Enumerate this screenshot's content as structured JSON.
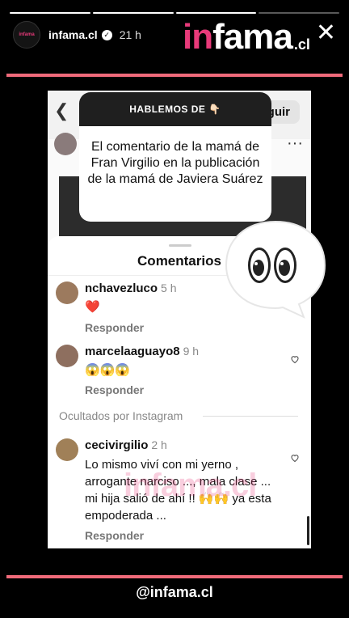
{
  "story": {
    "progress": {
      "total": 4,
      "active": 3
    },
    "account": "infama.cl",
    "avatar_text": "infama",
    "posted": "21 h",
    "handle": "@infama.cl"
  },
  "brand": {
    "logo_pink": "in",
    "logo_white": "fama",
    "logo_suffix": ".cl",
    "accent_color": "#e83a7a",
    "stripe_color": "#ef6a7a"
  },
  "question": {
    "header": "HABLEMOS DE 👇🏻",
    "body": "El comentario de la mamá de Fran Virgilio en la publicación de la mamá de Javiera Suárez"
  },
  "instagram": {
    "follow_label": "Seguir",
    "sheet_title": "Comentarios",
    "reply_label": "Responder",
    "hidden_label": "Ocultados por Instagram",
    "comments": [
      {
        "user": "nchavezluco",
        "ago": "5 h",
        "text": "❤️"
      },
      {
        "user": "marcelaaguayo8",
        "ago": "9 h",
        "text": "😱😱😱"
      },
      {
        "user": "cecivirgilio",
        "ago": "2 h",
        "text": "Lo mismo viví con mi yerno , arrogante narciso ..., mala clase ... mi hija salió de ahí !! 🙌🙌 ya esta empoderada ..."
      }
    ]
  },
  "icons": {
    "close": "close-icon",
    "verified": "verified-badge-icon",
    "heart": "heart-outline-icon",
    "eyes": "eyes-emoji-icon"
  }
}
